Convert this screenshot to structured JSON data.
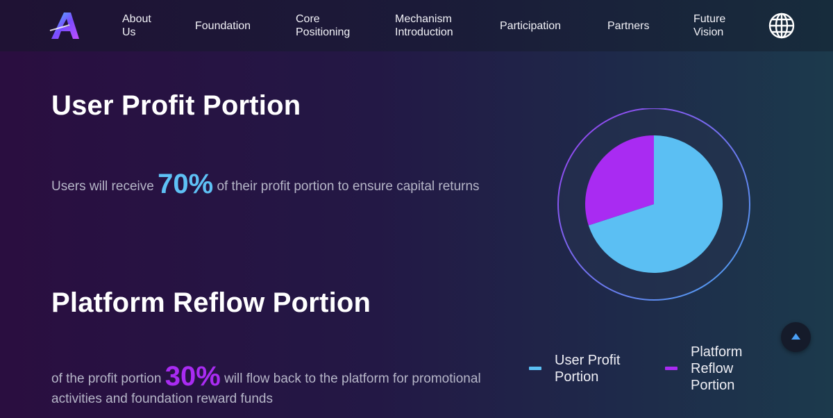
{
  "nav": {
    "items": [
      {
        "label_line1": "About",
        "label_line2": "Us"
      },
      {
        "label_line1": "Foundation",
        "label_line2": ""
      },
      {
        "label_line1": "Core",
        "label_line2": "Positioning"
      },
      {
        "label_line1": "Mechanism",
        "label_line2": "Introduction"
      },
      {
        "label_line1": "Participation",
        "label_line2": ""
      },
      {
        "label_line1": "Partners",
        "label_line2": ""
      },
      {
        "label_line1": "Future",
        "label_line2": "Vision"
      }
    ],
    "language_icon": "globe-icon",
    "logo_icon": "brand-logo-a"
  },
  "sections": {
    "user": {
      "title": "User Profit Portion",
      "text_before": "Users will receive",
      "percent": "70%",
      "text_after": "of their profit portion to ensure capital returns"
    },
    "platform": {
      "title": "Platform Reflow Portion",
      "text_before": "of the profit portion",
      "percent": "30%",
      "text_after": "will flow back to the platform for promotional",
      "text_line2": "activities and foundation reward funds"
    }
  },
  "chart_data": {
    "type": "pie",
    "title": "",
    "slices": [
      {
        "label": "User Profit Portion",
        "value": 70,
        "color": "#5bbff3"
      },
      {
        "label": "Platform Reflow Portion",
        "value": 30,
        "color": "#a92bf2"
      }
    ],
    "legend": {
      "placement": "bottom",
      "items": [
        {
          "line1": "User Profit",
          "line2": "Portion",
          "line3": ""
        },
        {
          "line1": "Platform",
          "line2": "Reflow",
          "line3": "Portion"
        }
      ]
    }
  },
  "scroll_top_icon": "arrow-up-icon",
  "colors": {
    "accent_blue": "#5ec1f5",
    "accent_purple": "#a92bf2"
  }
}
